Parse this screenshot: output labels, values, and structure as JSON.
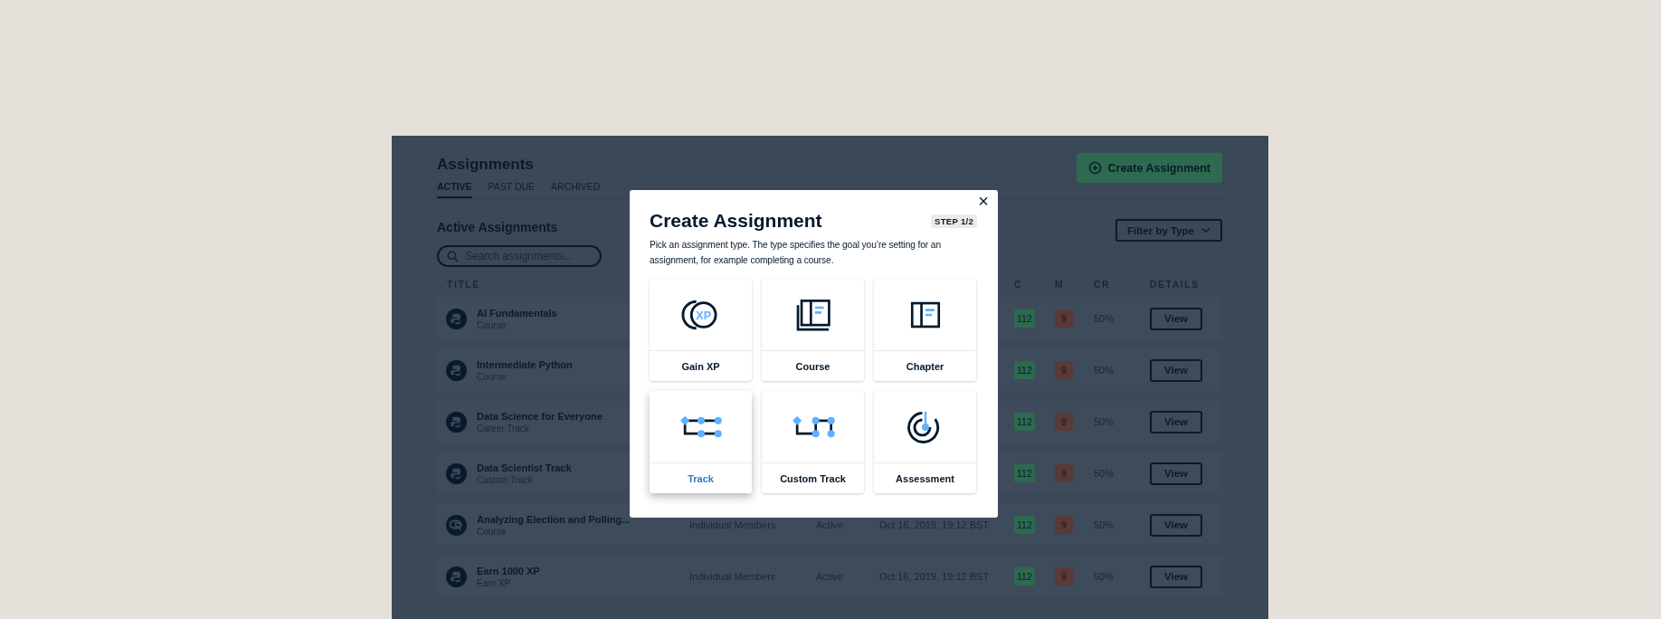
{
  "page": {
    "title": "Assignments",
    "create_button": "Create Assignment",
    "tabs": [
      {
        "label": "ACTIVE",
        "selected": true
      },
      {
        "label": "PAST DUE",
        "selected": false
      },
      {
        "label": "ARCHIVED",
        "selected": false
      }
    ],
    "section_title": "Active Assignments",
    "search": {
      "placeholder": "Search assignments..."
    },
    "filter_button": "Filter by Type",
    "table": {
      "columns": {
        "title": "TITLE",
        "c": "C",
        "m": "M",
        "cr": "CR",
        "details": "DETAILS"
      },
      "rows": [
        {
          "kind": "python",
          "title": "AI Fundamentals",
          "type": "Course",
          "c": "112",
          "m": "9",
          "cr": "50%",
          "action": "View"
        },
        {
          "kind": "python",
          "title": "Intermediate Python",
          "type": "Course",
          "c": "112",
          "m": "9",
          "cr": "50%",
          "action": "View"
        },
        {
          "kind": "python",
          "title": "Data Science for Everyone",
          "type": "Career Track",
          "c": "112",
          "m": "9",
          "cr": "50%",
          "action": "View"
        },
        {
          "kind": "python",
          "title": "Data Scientist Track",
          "type": "Custom Track",
          "c": "112",
          "m": "9",
          "cr": "50%",
          "action": "View"
        },
        {
          "kind": "r",
          "title": "Analyzing Election and Polling...",
          "type": "Course",
          "column_2": "Individual Members",
          "column_3": "Active",
          "column_4": "Oct 16, 2019, 19:12 BST",
          "c": "112",
          "m": "9",
          "cr": "50%",
          "action": "View"
        },
        {
          "kind": "python",
          "title": "Earn 1000 XP",
          "type": "Earn XP",
          "column_2": "Individual Members",
          "column_3": "Active",
          "column_4": "Oct 16, 2019, 19:12 BST",
          "c": "112",
          "m": "9",
          "cr": "50%",
          "action": "View"
        }
      ]
    }
  },
  "modal": {
    "close": "×",
    "title": "Create Assignment",
    "step": "STEP 1/2",
    "description": "Pick an assignment type. The type specifies the goal you’re setting for an assignment, for example completing a course.",
    "options": [
      {
        "kind": "xp",
        "icon_text": "XP",
        "label": "Gain XP",
        "selected": false
      },
      {
        "kind": "course",
        "label": "Course",
        "selected": false
      },
      {
        "kind": "chapter",
        "label": "Chapter",
        "selected": false
      },
      {
        "kind": "track",
        "label": "Track",
        "selected": true
      },
      {
        "kind": "custom_track",
        "label": "Custom Track",
        "selected": false
      },
      {
        "kind": "assessment",
        "label": "Assessment",
        "selected": false
      }
    ]
  }
}
